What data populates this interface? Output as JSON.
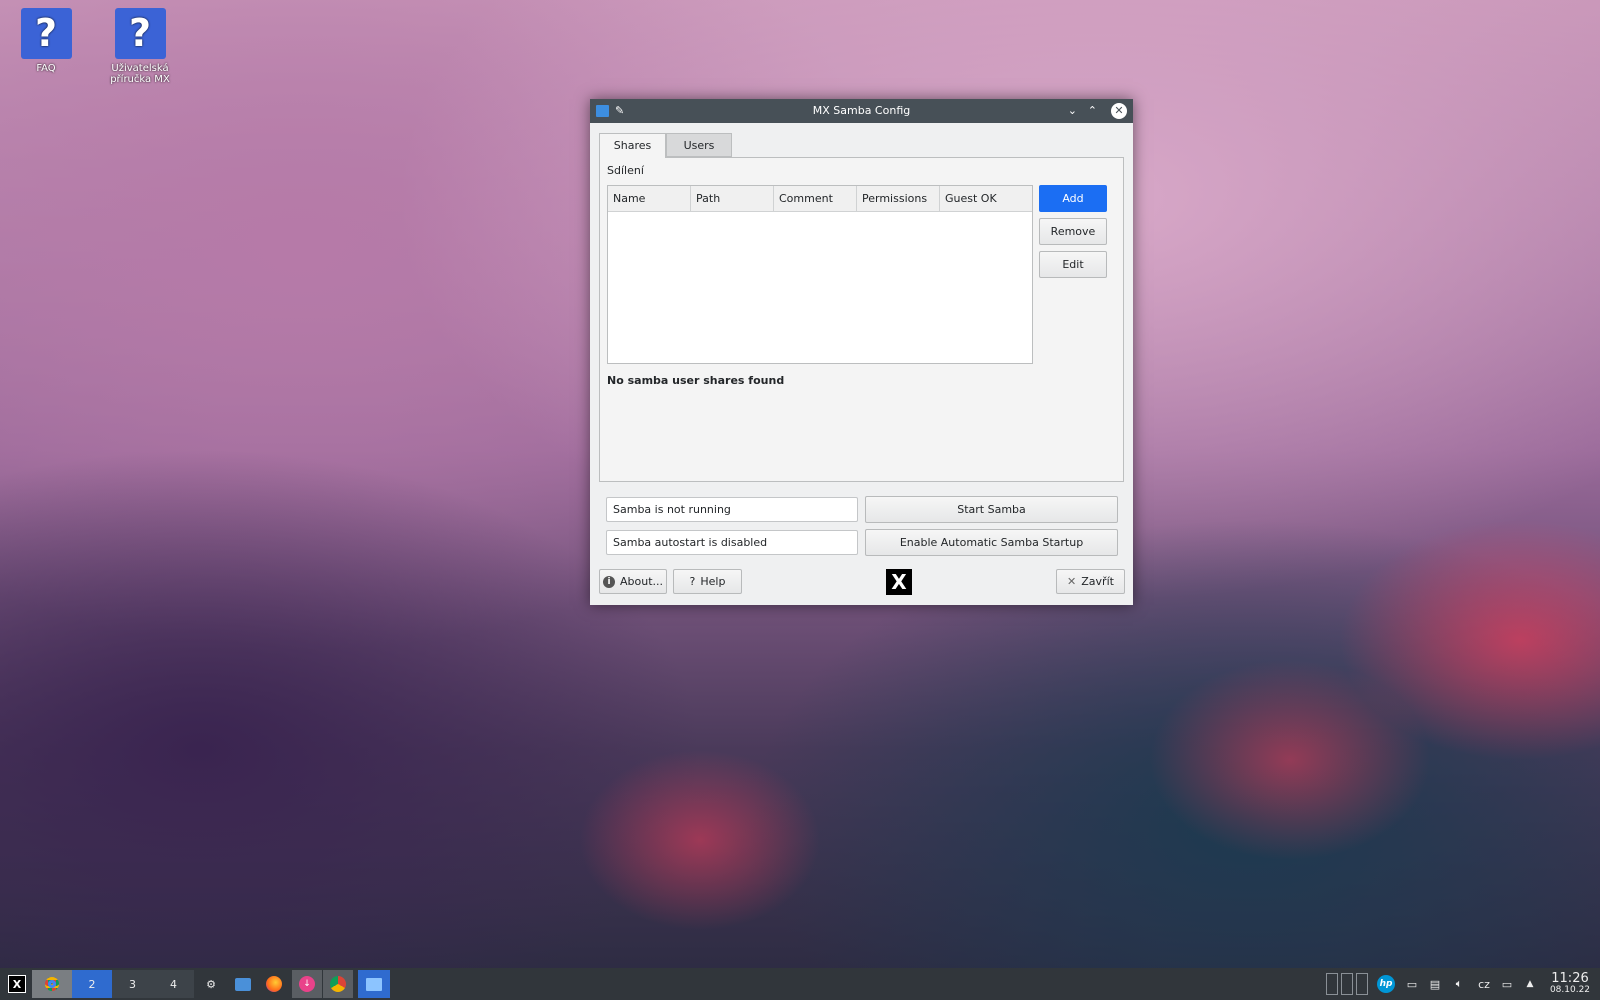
{
  "desktop": {
    "icons": [
      {
        "label": "FAQ",
        "icon": "help-icon"
      },
      {
        "label": "Uživatelská příručka MX",
        "icon": "help-icon"
      }
    ]
  },
  "window": {
    "title": "MX Samba Config",
    "tabs": [
      {
        "label": "Shares",
        "active": true
      },
      {
        "label": "Users",
        "active": false
      }
    ],
    "section_label": "Sdílení",
    "table": {
      "columns": [
        "Name",
        "Path",
        "Comment",
        "Permissions",
        "Guest OK"
      ],
      "rows": []
    },
    "buttons": {
      "add": "Add",
      "remove": "Remove",
      "edit": "Edit",
      "start": "Start Samba",
      "autostart": "Enable Automatic Samba Startup",
      "about": "About...",
      "help": "Help",
      "close": "Zavřít"
    },
    "empty_message": "No samba user shares found",
    "status": {
      "running": "Samba is not running",
      "autostart": "Samba autostart is disabled"
    },
    "accent": "#1b6ef3"
  },
  "taskbar": {
    "workspaces": [
      "2",
      "3",
      "4"
    ],
    "active_workspace": "2",
    "keyboard_layout": "cz",
    "time": "11:26",
    "date": "08.10.22"
  }
}
